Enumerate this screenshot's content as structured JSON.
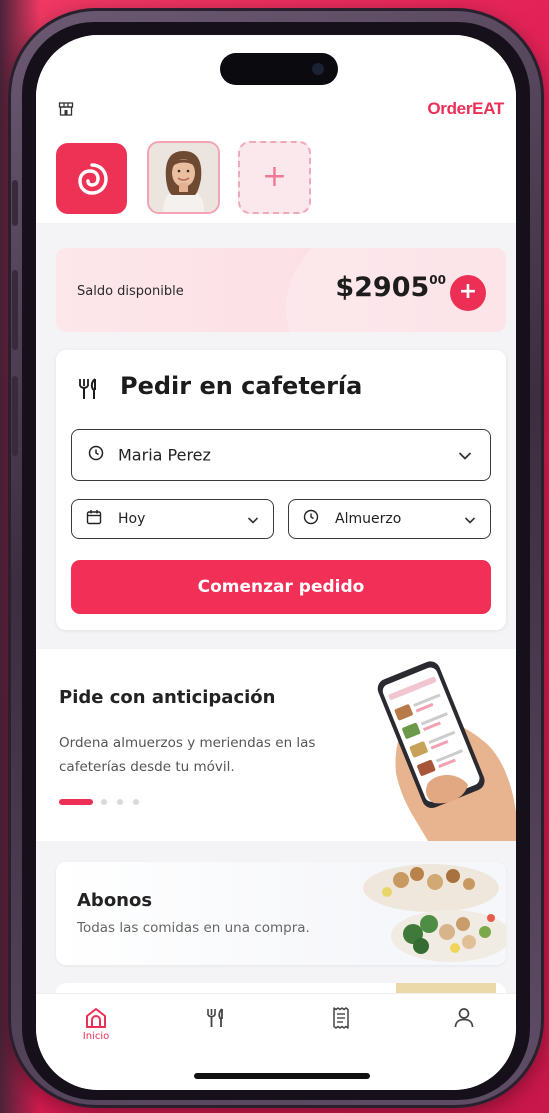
{
  "header": {
    "brand": "OrderEAT",
    "store_icon": "store-icon"
  },
  "profiles": {
    "app_logo_icon": "swirl-logo-icon",
    "avatar_alt": "avatar",
    "add_label": "+"
  },
  "balance": {
    "label": "Saldo disponible",
    "amount": "$2905",
    "cents": "00",
    "add_label": "+"
  },
  "order": {
    "title": "Pedir en cafetería",
    "person": "Maria Perez",
    "day": "Hoy",
    "meal": "Almuerzo",
    "cta": "Comenzar pedido"
  },
  "promo": {
    "title": "Pide con anticipación",
    "description": "Ordena almuerzos y meriendas en las cafeterías desde tu móvil.",
    "slides": 4,
    "active_slide": 0
  },
  "abonos": {
    "title": "Abonos",
    "subtitle": "Todas las comidas en una compra."
  },
  "tabbar": {
    "items": [
      {
        "name": "home",
        "label": "Inicio",
        "icon": "home-icon",
        "active": true
      },
      {
        "name": "cafeteria",
        "label": "",
        "icon": "utensils-icon",
        "active": false
      },
      {
        "name": "orders",
        "label": "",
        "icon": "receipt-icon",
        "active": false
      },
      {
        "name": "profile",
        "label": "",
        "icon": "user-icon",
        "active": false
      }
    ]
  },
  "colors": {
    "accent": "#ee2f55",
    "background": "#e8265a",
    "balance_card": "#fce7eb"
  }
}
